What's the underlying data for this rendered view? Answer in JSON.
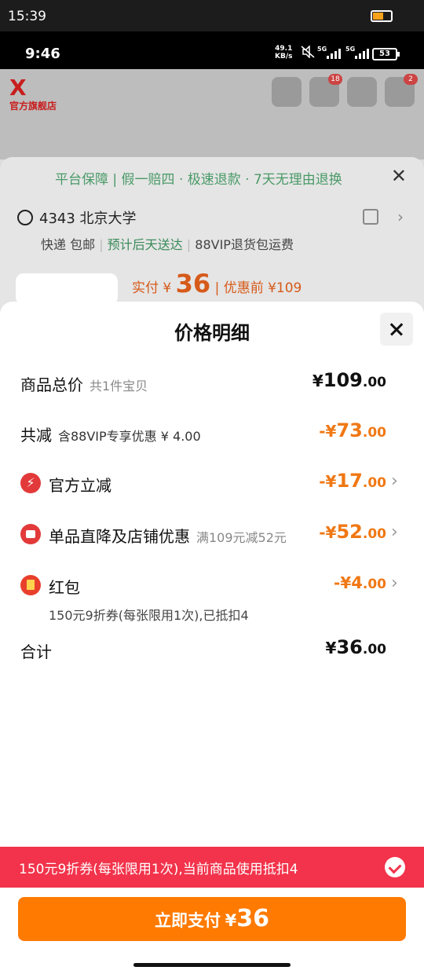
{
  "outer_status": {
    "time": "15:39"
  },
  "phone_status": {
    "time": "9:46",
    "speed_value": "49.1",
    "speed_unit": "KB/s",
    "sim1": "5G",
    "sim2": "5G",
    "battery": "53"
  },
  "background": {
    "store_logo_text": "官方旗舰店",
    "cart_badge": "18",
    "msg_badge": "2",
    "guarantee": "平台保障 | 假一赔四 · 极速退款 · 7天无理由退换",
    "address": "4343 北京大学",
    "shipping": "快递 包邮",
    "delivery": "预计后天送达",
    "return_fee": "88VIP退货包运费",
    "pay_prefix": "实付 ¥",
    "pay_amount": "36",
    "pay_before": "| 优惠前 ¥109"
  },
  "modal": {
    "title": "价格明细",
    "rows": [
      {
        "label": "商品总价",
        "sub": "共1件宝贝",
        "currency": "¥",
        "int": "109",
        "dec": ".00"
      },
      {
        "label": "共减",
        "sub": "含88VIP专享优惠 ¥ 4.00",
        "currency": "-¥",
        "int": "73",
        "dec": ".00"
      },
      {
        "label": "官方立减",
        "sub": "",
        "currency": "-¥",
        "int": "17",
        "dec": ".00"
      },
      {
        "label": "单品直降及店铺优惠",
        "sub": "满109元减52元",
        "currency": "-¥",
        "int": "52",
        "dec": ".00"
      },
      {
        "label": "红包",
        "sub": "",
        "currency": "-¥",
        "int": "4",
        "dec": ".00"
      },
      {
        "label": "合计",
        "sub": "",
        "currency": "¥",
        "int": "36",
        "dec": ".00"
      }
    ],
    "coupon_note": "150元9折券(每张限用1次),已抵扣4"
  },
  "banner": {
    "text": "150元9折券(每张限用1次),当前商品使用抵扣4"
  },
  "pay_button": {
    "label": "立即支付",
    "currency": "¥",
    "amount": "36"
  },
  "colors": {
    "accent": "#ff7a00",
    "discount": "#f07814",
    "banner": "#f2334b",
    "guarantee_green": "#4a9a68"
  },
  "icons": [
    "lightning-icon",
    "store-icon",
    "red-packet-icon",
    "close-icon",
    "chevron-right-icon",
    "check-icon"
  ]
}
